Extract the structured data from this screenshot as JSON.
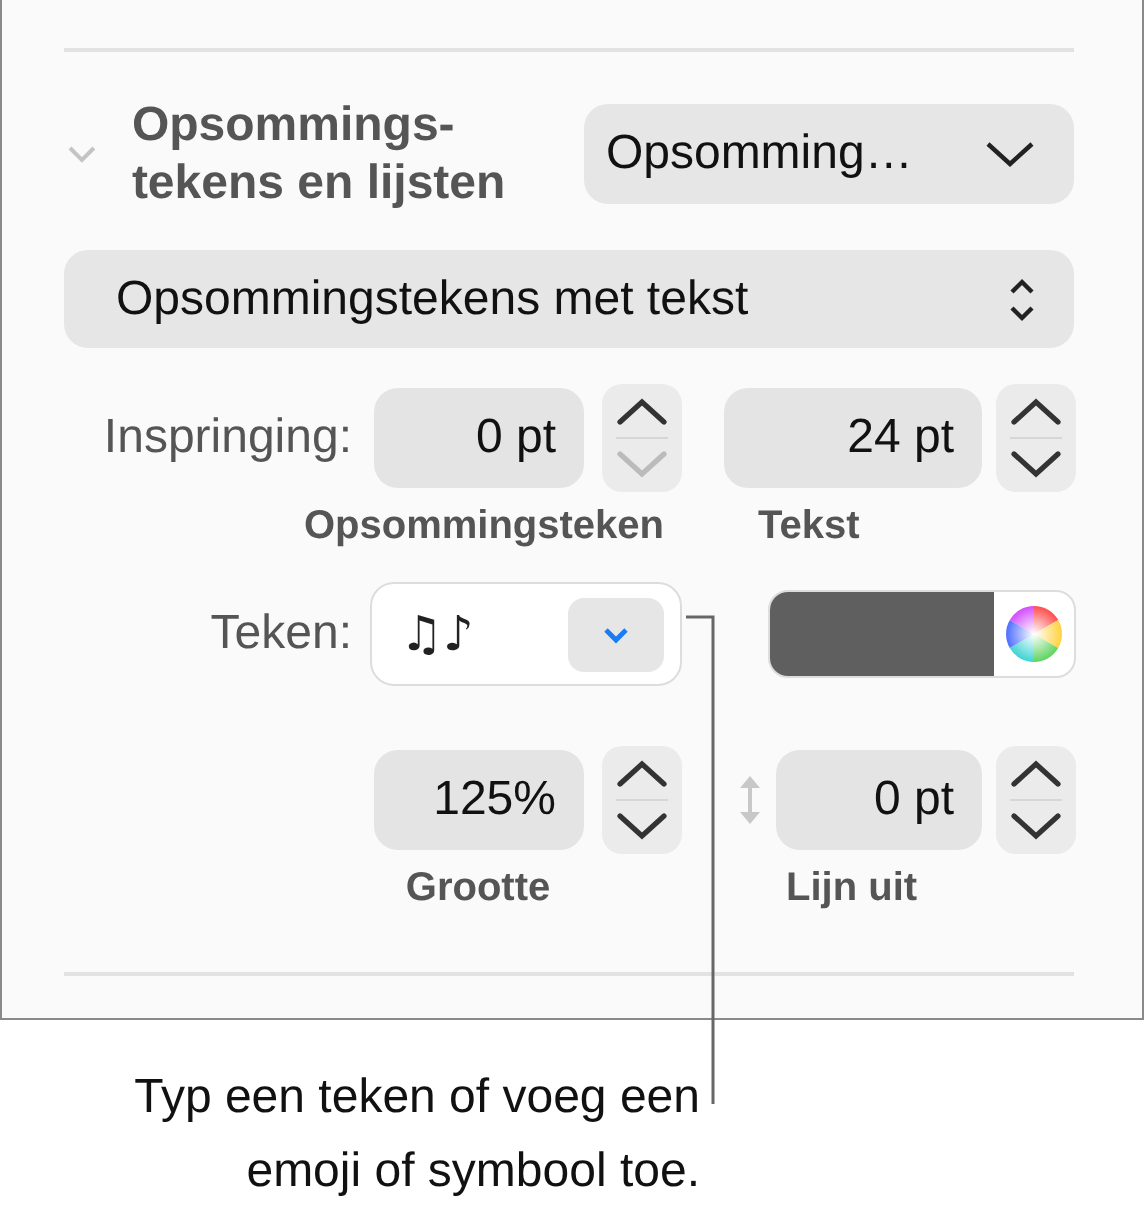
{
  "section": {
    "title_lines": [
      "Opsommings-",
      "tekens en lijsten"
    ],
    "expanded": true,
    "style_popup": "Opsomming…"
  },
  "list_type_popup": "Opsommingstekens met tekst",
  "indent": {
    "label": "Inspringing:",
    "fields": [
      {
        "value": "0 pt",
        "caption": "Opsommingsteken",
        "up_disabled": false,
        "down_disabled": true
      },
      {
        "value": "24 pt",
        "caption": "Tekst",
        "up_disabled": false,
        "down_disabled": false
      }
    ]
  },
  "bullet": {
    "label": "Teken:",
    "value": "♫♪",
    "color": "#5f5f5f"
  },
  "size": {
    "value": "125%",
    "caption": "Grootte",
    "up_disabled": false,
    "down_disabled": false
  },
  "baseline": {
    "value": "0 pt",
    "caption": "Lijn uit",
    "up_disabled": false,
    "down_disabled": false
  },
  "callout": {
    "lines": [
      "Typ een teken of voeg een",
      "emoji of symbool toe."
    ]
  }
}
